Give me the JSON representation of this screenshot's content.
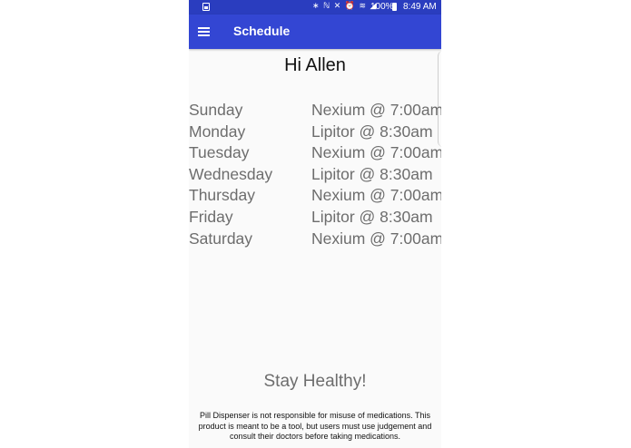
{
  "status_bar": {
    "icons_text": "∗ ℕ ✕ ⏰ ≋ ◢",
    "battery_percent": "100%",
    "time": "8:49 AM"
  },
  "app_bar": {
    "title": "Schedule"
  },
  "greeting": "Hi Allen",
  "schedule": [
    {
      "day": "Sunday",
      "medication": "Nexium @ 7:00am"
    },
    {
      "day": "Monday",
      "medication": "Lipitor @ 8:30am"
    },
    {
      "day": "Tuesday",
      "medication": "Nexium @ 7:00am"
    },
    {
      "day": "Wednesday",
      "medication": "Lipitor @ 8:30am"
    },
    {
      "day": "Thursday",
      "medication": "Nexium @ 7:00am"
    },
    {
      "day": "Friday",
      "medication": "Lipitor @ 8:30am"
    },
    {
      "day": "Saturday",
      "medication": "Nexium @ 7:00am"
    }
  ],
  "footer": {
    "message": "Stay Healthy!",
    "disclaimer_lines": [
      "Pill Dispenser is not responsible for misuse of medications.  This",
      "product is meant to be a tool, but users must use judgement and",
      "consult their doctors before taking medications."
    ]
  },
  "colors": {
    "status_bar": "#2a3dbf",
    "app_bar": "#3346d3",
    "background": "#fafafa",
    "schedule_text": "#6d6d6d"
  },
  "icons": {
    "menu": "hamburger-menu-icon",
    "gallery": "image-icon",
    "battery": "battery-icon"
  }
}
